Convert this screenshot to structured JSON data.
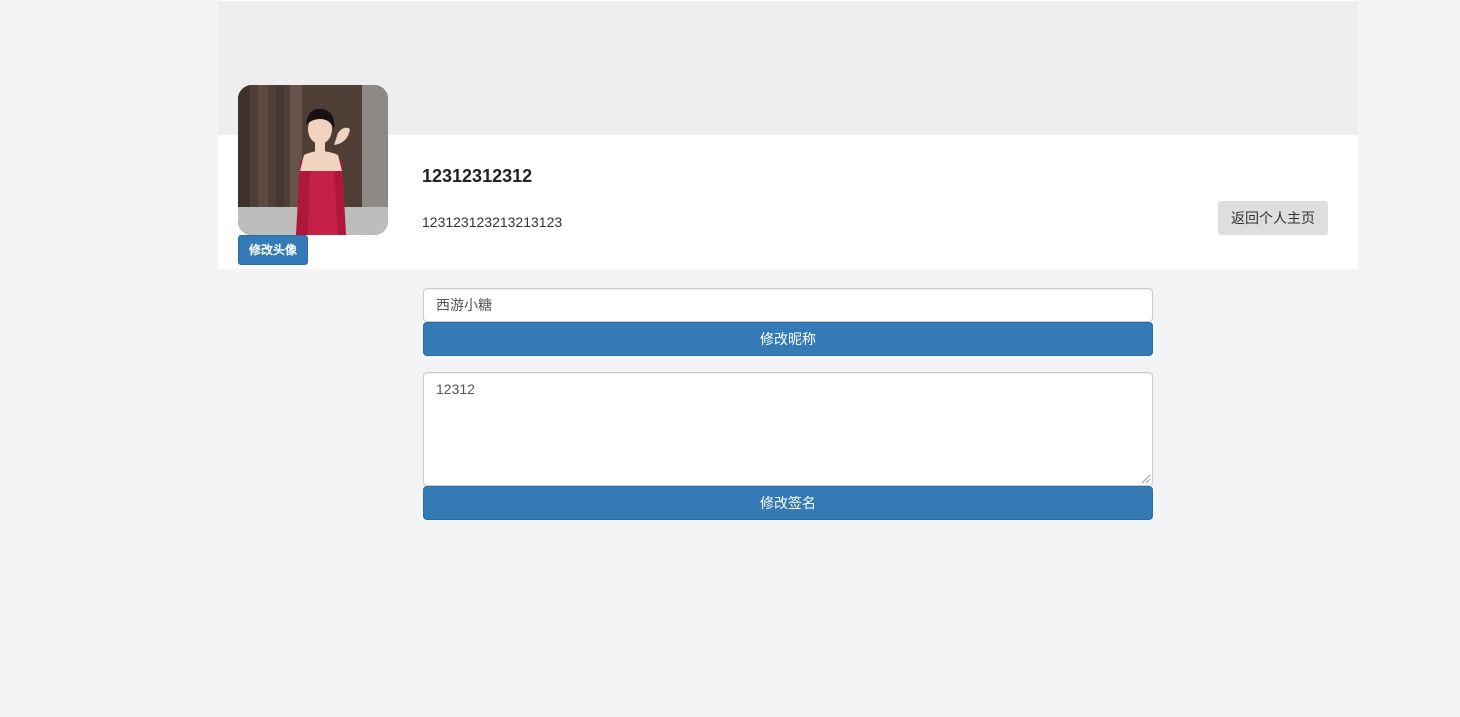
{
  "profile": {
    "username": "12312312312",
    "signature": "123123123213213123",
    "change_avatar_label": "修改头像",
    "back_label": "返回个人主页"
  },
  "form": {
    "nickname_value": "西游小糖",
    "nickname_button": "修改昵称",
    "signature_value": "12312",
    "signature_button": "修改签名"
  },
  "colors": {
    "primary": "#337ab7",
    "cover": "#eeeeee",
    "background": "#f3f4f6",
    "back_button": "#dedede"
  }
}
